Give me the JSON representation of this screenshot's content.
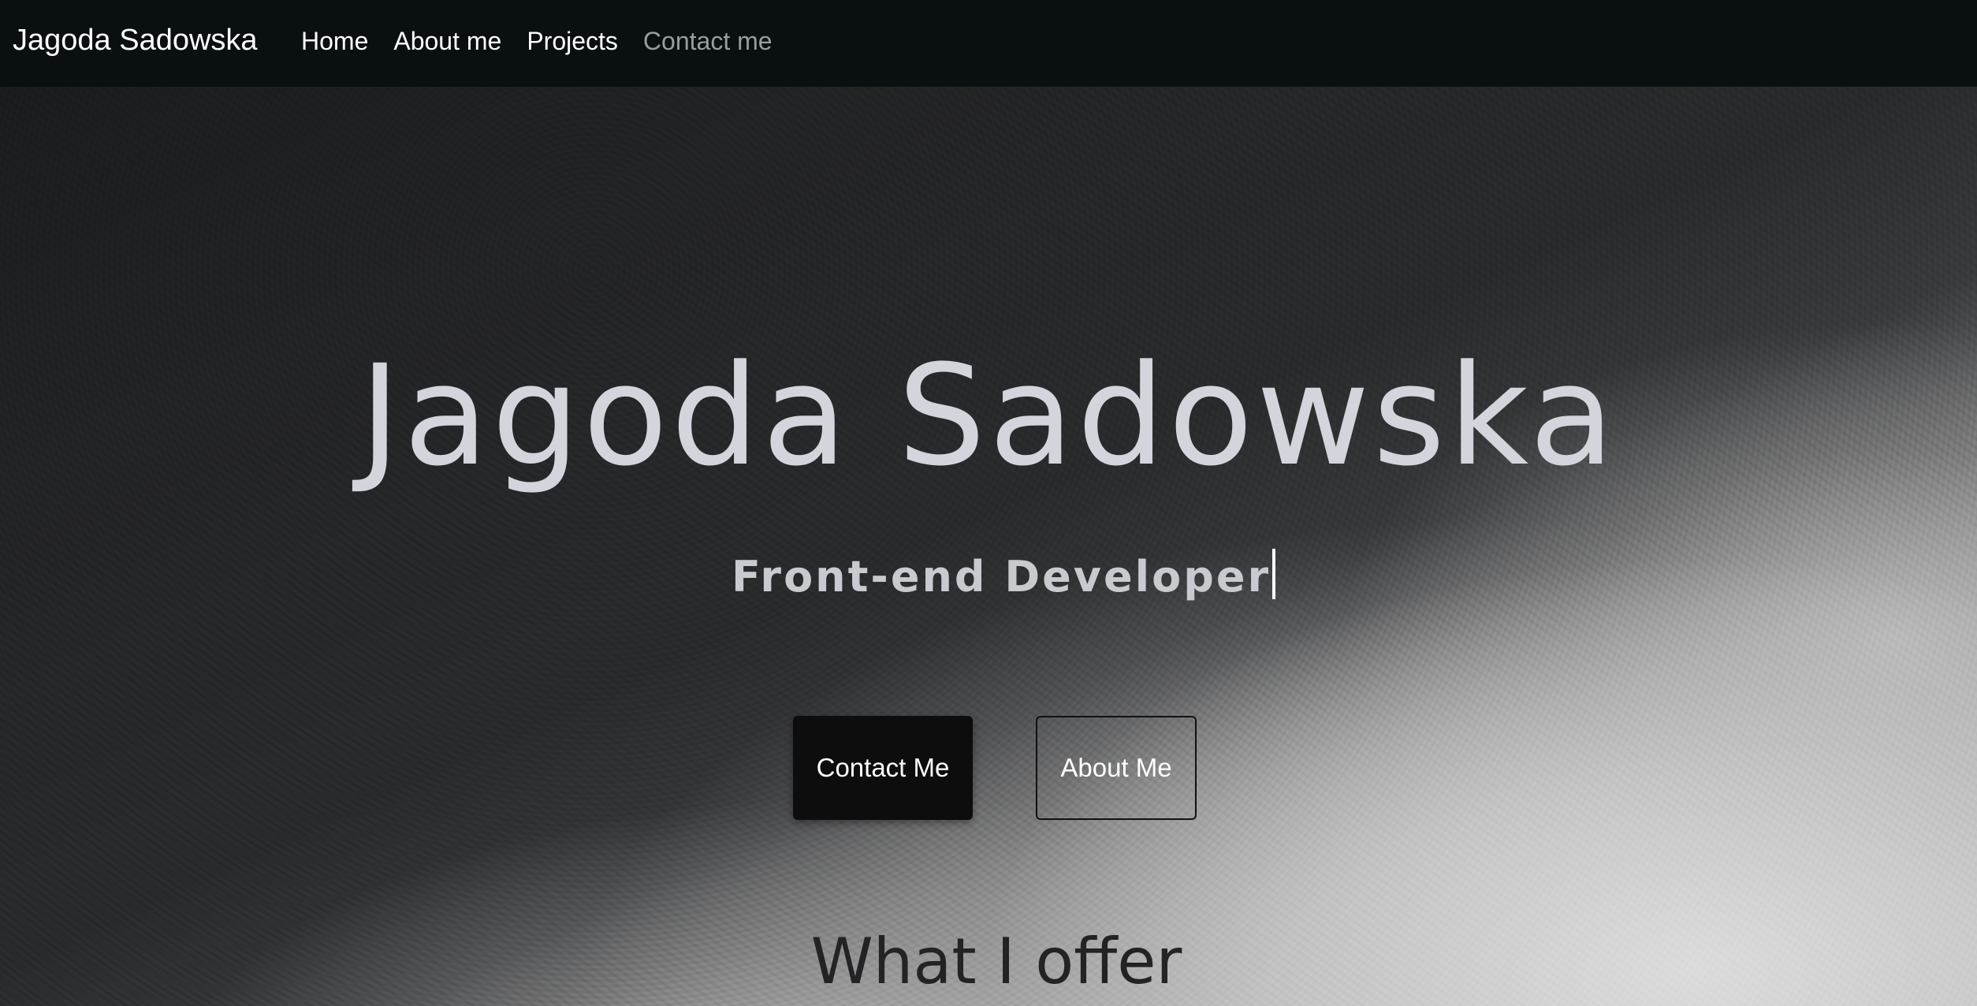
{
  "navbar": {
    "brand": "Jagoda Sadowska",
    "links": [
      {
        "label": "Home"
      },
      {
        "label": "About me"
      },
      {
        "label": "Projects"
      },
      {
        "label": "Contact me"
      }
    ]
  },
  "hero": {
    "title": "Jagoda Sadowska",
    "subtitle": "Front-end Developer",
    "contact_button": "Contact Me",
    "about_button": "About Me"
  },
  "offer": {
    "heading": "What I offer"
  },
  "colors": {
    "navbar_bg": "#0a1012",
    "title_text": "#d4d4dc",
    "contact_button_bg": "#0d0d0d",
    "muted_link": "#9a9c9e"
  }
}
